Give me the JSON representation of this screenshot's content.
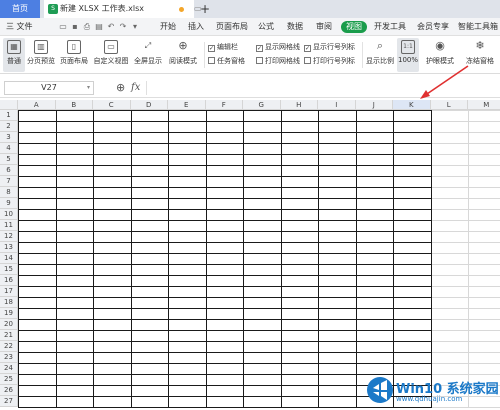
{
  "tabs": {
    "home_label": "首页",
    "doc_label": "新建 XLSX 工作表.xlsx",
    "new_tab_symbol": "+"
  },
  "menubar": {
    "file_label": "三 文件",
    "items": [
      "开始",
      "插入",
      "页面布局",
      "公式",
      "数据",
      "审阅",
      "视图",
      "开发工具",
      "会员专享",
      "智能工具箱"
    ],
    "active_item": "视图"
  },
  "ribbon": {
    "buttons": [
      "普通",
      "分页预览",
      "页面布局",
      "自定义视图",
      "全屏显示",
      "阅读模式",
      "显示比例",
      "100%",
      "护眼模式",
      "冻结窗格"
    ],
    "selected_button": "普通",
    "checkboxes": [
      {
        "label": "编辑栏",
        "checked": true
      },
      {
        "label": "任务窗格",
        "checked": false
      },
      {
        "label": "显示网格线",
        "checked": true
      },
      {
        "label": "打印网格线",
        "checked": false
      },
      {
        "label": "显示行号列标",
        "checked": true
      },
      {
        "label": "打印行号列标",
        "checked": false
      }
    ]
  },
  "formula_bar": {
    "cell_ref": "V27",
    "fx_label": "fx",
    "value": ""
  },
  "sheet": {
    "columns": [
      "A",
      "B",
      "C",
      "D",
      "E",
      "F",
      "G",
      "H",
      "I",
      "J",
      "K",
      "L",
      "M"
    ],
    "rows": [
      "1",
      "2",
      "3",
      "4",
      "5",
      "6",
      "7",
      "8",
      "9",
      "10",
      "11",
      "12",
      "13",
      "14",
      "15",
      "16",
      "17",
      "18",
      "19",
      "20",
      "21",
      "22",
      "23",
      "24",
      "25",
      "26",
      "27"
    ],
    "bordered_columns": [
      "A",
      "B",
      "C",
      "D",
      "E",
      "F",
      "G",
      "H",
      "I",
      "J",
      "K"
    ]
  },
  "colors": {
    "accent": "#1a9c4b",
    "home_tab": "#4d7fe2",
    "annotation_arrow": "#e03030"
  },
  "watermark": {
    "title": "Win10 系统家园",
    "url": "www.qdhuajin.com"
  }
}
